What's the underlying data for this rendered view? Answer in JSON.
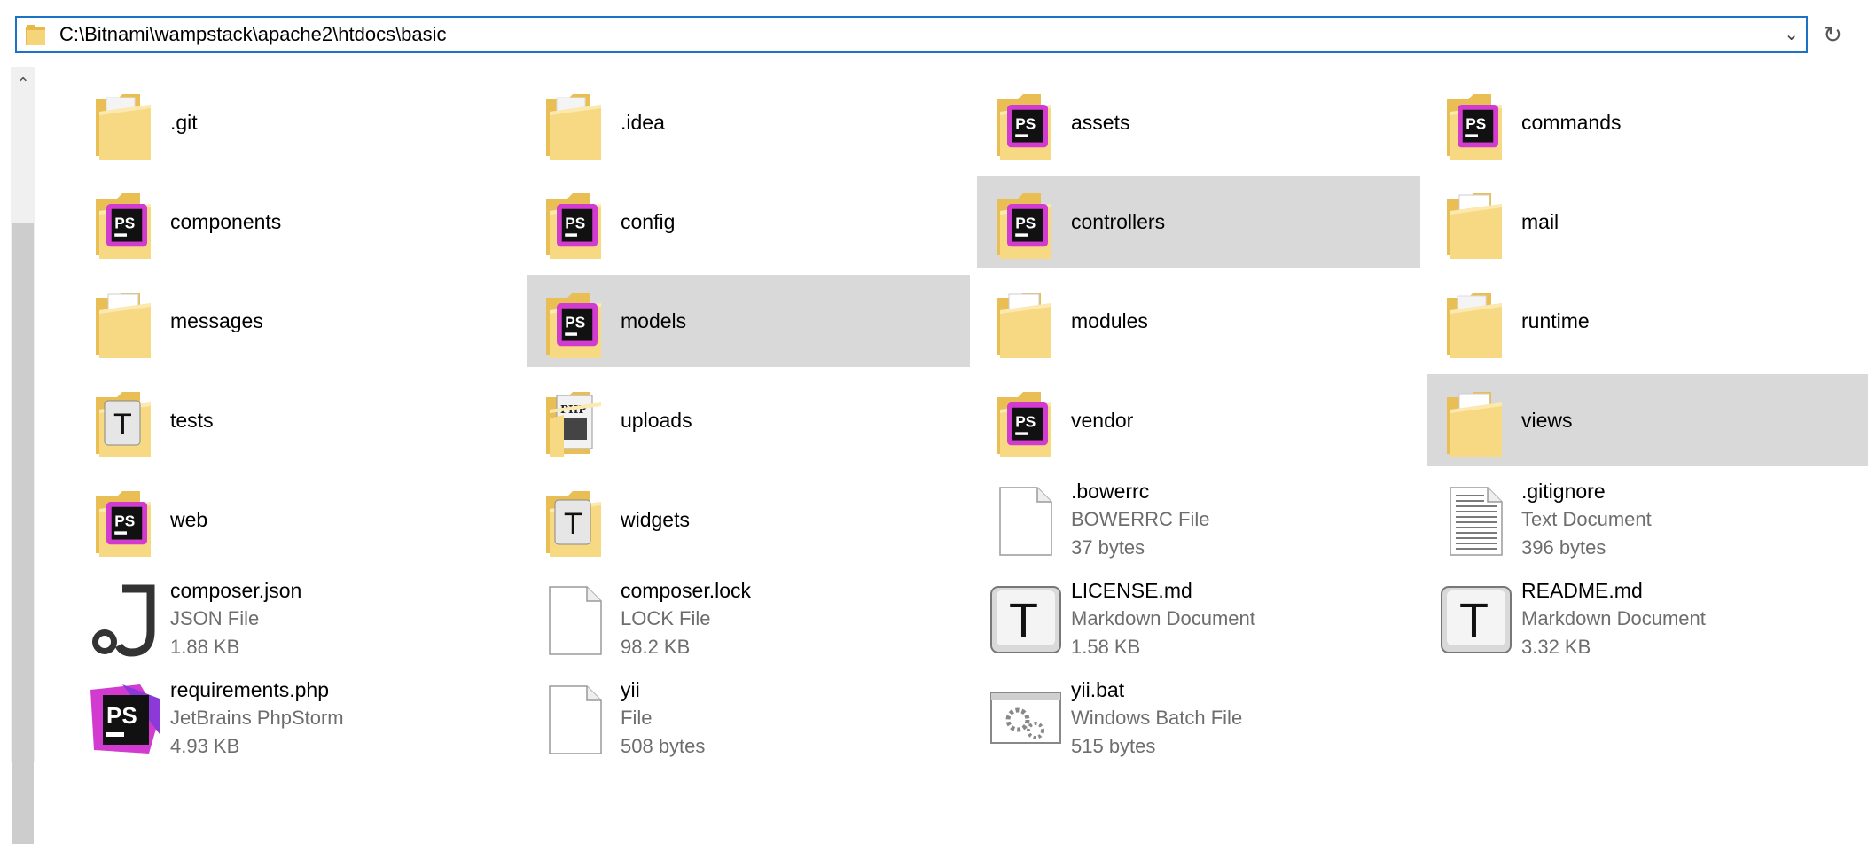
{
  "address_bar": {
    "path": "C:\\Bitnami\\wampstack\\apache2\\htdocs\\basic"
  },
  "items": [
    {
      "name": ".git",
      "kind": "folder-plain"
    },
    {
      "name": ".idea",
      "kind": "folder-plain"
    },
    {
      "name": "assets",
      "kind": "folder-ps"
    },
    {
      "name": "commands",
      "kind": "folder-ps"
    },
    {
      "name": "components",
      "kind": "folder-ps"
    },
    {
      "name": "config",
      "kind": "folder-ps"
    },
    {
      "name": "controllers",
      "kind": "folder-ps",
      "selected": true
    },
    {
      "name": "mail",
      "kind": "folder-docs"
    },
    {
      "name": "messages",
      "kind": "folder-docs"
    },
    {
      "name": "models",
      "kind": "folder-ps",
      "selected": true
    },
    {
      "name": "modules",
      "kind": "folder-docs"
    },
    {
      "name": "runtime",
      "kind": "folder-plain"
    },
    {
      "name": "tests",
      "kind": "folder-t"
    },
    {
      "name": "uploads",
      "kind": "folder-php"
    },
    {
      "name": "vendor",
      "kind": "folder-ps"
    },
    {
      "name": "views",
      "kind": "folder-docs",
      "selected": true
    },
    {
      "name": "web",
      "kind": "folder-ps"
    },
    {
      "name": "widgets",
      "kind": "folder-t"
    },
    {
      "name": ".bowerrc",
      "type": "BOWERRC File",
      "size": "37 bytes",
      "kind": "file-blank"
    },
    {
      "name": ".gitignore",
      "type": "Text Document",
      "size": "396 bytes",
      "kind": "file-text"
    },
    {
      "name": "composer.json",
      "type": "JSON File",
      "size": "1.88 KB",
      "kind": "file-json"
    },
    {
      "name": "composer.lock",
      "type": "LOCK File",
      "size": "98.2 KB",
      "kind": "file-blank"
    },
    {
      "name": "LICENSE.md",
      "type": "Markdown Document",
      "size": "1.58 KB",
      "kind": "file-t"
    },
    {
      "name": "README.md",
      "type": "Markdown Document",
      "size": "3.32 KB",
      "kind": "file-t"
    },
    {
      "name": "requirements.php",
      "type": "JetBrains PhpStorm",
      "size": "4.93 KB",
      "kind": "file-ps"
    },
    {
      "name": "yii",
      "type": "File",
      "size": "508 bytes",
      "kind": "file-blank"
    },
    {
      "name": "yii.bat",
      "type": "Windows Batch File",
      "size": "515 bytes",
      "kind": "file-bat"
    }
  ],
  "colors": {
    "selection": "#d9d9d9",
    "address_border": "#1a73c7",
    "meta_text": "#6d6d6d",
    "folder": "#f5d47a"
  }
}
